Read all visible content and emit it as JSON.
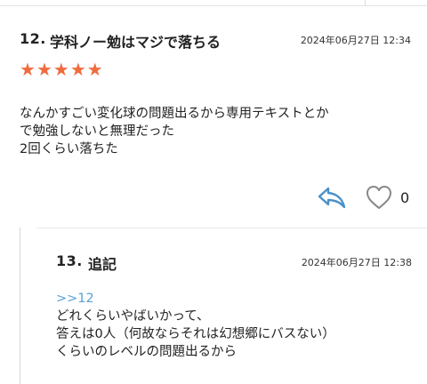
{
  "comments": [
    {
      "number": "12.",
      "title": "学科ノー勉はマジで落ちる",
      "date": "2024年06月27日 12:34",
      "rating": 5,
      "stars": [
        "★",
        "★",
        "★",
        "★",
        "★"
      ],
      "body": [
        "なんかすごい変化球の問題出るから専用テキストとか",
        "で勉強しないと無理だった",
        "2回くらい落ちた"
      ],
      "like_count": "0",
      "icons": {
        "reply": "reply-arrow-icon",
        "like": "heart-icon"
      },
      "colors": {
        "stars": "#f06b3d",
        "reply_icon": "#4a90c8",
        "like_icon": "#888888"
      }
    },
    {
      "number": "13.",
      "title": "追記",
      "date": "2024年06月27日 12:38",
      "anchor": ">>12",
      "body": [
        "どれくらいやばいかって、",
        "答えは0人（何故ならそれは幻想郷にバスない）",
        "くらいのレベルの問題出るから"
      ],
      "colors": {
        "anchor": "#5aa0d6"
      }
    }
  ]
}
